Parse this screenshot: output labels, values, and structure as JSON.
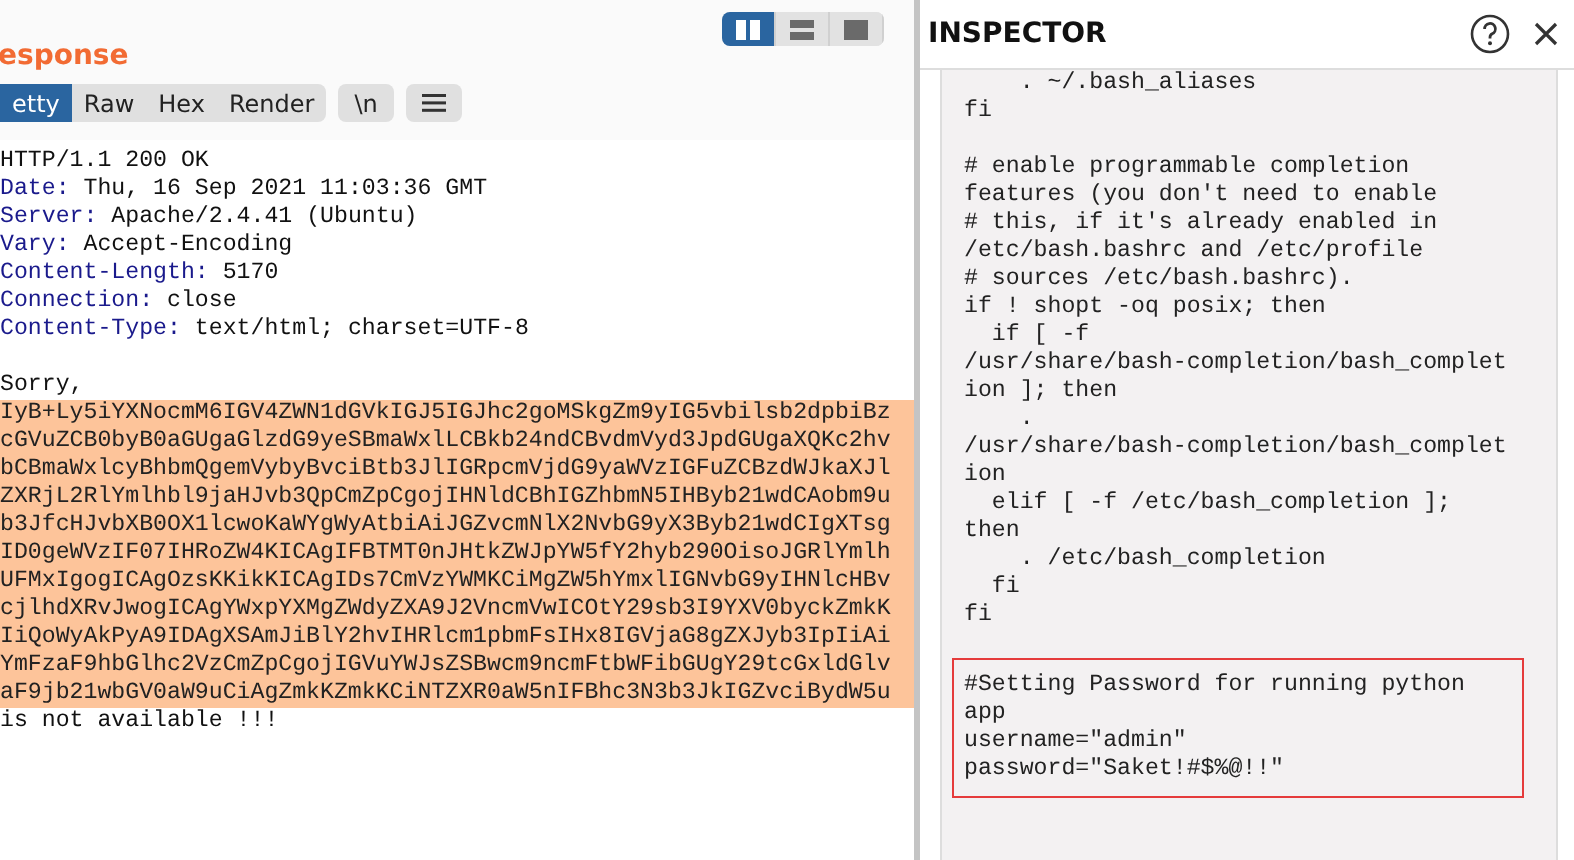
{
  "response": {
    "title": "esponse",
    "view_modes": [
      {
        "kind": "split",
        "selected": true
      },
      {
        "kind": "stacked",
        "selected": false
      },
      {
        "kind": "single",
        "selected": false
      }
    ],
    "tabs": [
      {
        "label": "etty",
        "selected": true
      },
      {
        "label": "Raw",
        "selected": false
      },
      {
        "label": "Hex",
        "selected": false
      },
      {
        "label": "Render",
        "selected": false
      }
    ],
    "newline_toggle": {
      "label": "\\n"
    },
    "status_line": "HTTP/1.1 200 OK",
    "headers": [
      {
        "name": "Date:",
        "value": "Thu, 16 Sep 2021 11:03:36 GMT"
      },
      {
        "name": "Server:",
        "value": "Apache/2.4.41 (Ubuntu)"
      },
      {
        "name": "Vary:",
        "value": "Accept-Encoding"
      },
      {
        "name": "Content-Length:",
        "value": "5170"
      },
      {
        "name": "Connection:",
        "value": "close"
      },
      {
        "name": "Content-Type:",
        "value": "text/html; charset=UTF-8"
      }
    ],
    "body_before": "Sorry,",
    "encoded_lines": [
      "IyB+Ly5iYXNocmM6IGV4ZWN1dGVkIGJ5IGJhc2goMSkgZm9yIG5vbilsb2dpbiBz",
      "cGVuZCB0byB0aGUgaGlzdG9yeSBmaWxlLCBkb24ndCBvdmVyd3JpdGUgaXQKc2hv",
      "bCBmaWxlcyBhbmQgemVybyBvciBtb3JlIGRpcmVjdG9yaWVzIGFuZCBzdWJkaXJl",
      "ZXRjL2RlYmlhbl9jaHJvb3QpCmZpCgojIHNldCBhIGZhbmN5IHByb21wdCAobm9u",
      "b3JfcHJvbXB0OX1lcwoKaWYgWyAtbiAiJGZvcmNlX2NvbG9yX3Byb21wdCIgXTsg",
      "ID0geWVzIF07IHRoZW4KICAgIFBTMT0nJHtkZWJpYW5fY2hyb290OisoJGRlYmlh",
      "UFMxIgogICAgOzsKKikKICAgIDs7CmVzYWMKCiMgZW5hYmxlIGNvbG9yIHNlcHBv",
      "cjlhdXRvJwogICAgYWxpYXMgZWdyZXA9J2VncmVwICOtY29sb3I9YXV0byckZmkK",
      "IiQoWyAkPyA9IDAgXSAmJiBlY2hvIHRlcm1pbmFsIHx8IGVjaG8gZXJyb3IpIiAi",
      "YmFzaF9hbGlhc2VzCmZpCgojIGVuYWJsZSBwcm9ncmFtbWFibGUgY29tcGxldGlv",
      "aF9jb21wbGV0aW9uCiAgZmkKZmkKCiNTZXR0aW5nIFBhc3N3b3JkIGZvciBydW5u"
    ],
    "body_after": "is not available !!!"
  },
  "inspector": {
    "title": "INSPECTOR",
    "code_blocks": [
      {
        "highlighted": false,
        "lines": [
          "    . ~/.bash_aliases",
          "fi"
        ]
      },
      {
        "highlighted": false,
        "lines": [
          "# enable programmable completion",
          "features (you don't need to enable",
          "# this, if it's already enabled in",
          "/etc/bash.bashrc and /etc/profile",
          "# sources /etc/bash.bashrc).",
          "if ! shopt -oq posix; then",
          "  if [ -f",
          "/usr/share/bash-completion/bash_complet",
          "ion ]; then",
          "    .",
          "/usr/share/bash-completion/bash_complet",
          "ion",
          "  elif [ -f /etc/bash_completion ];",
          "then",
          "    . /etc/bash_completion",
          "  fi",
          "fi"
        ]
      },
      {
        "highlighted": true,
        "lines": [
          "#Setting Password for running python",
          "app",
          "username=\"admin\"",
          "password=\"Saket!#$%@!!\""
        ]
      }
    ]
  }
}
